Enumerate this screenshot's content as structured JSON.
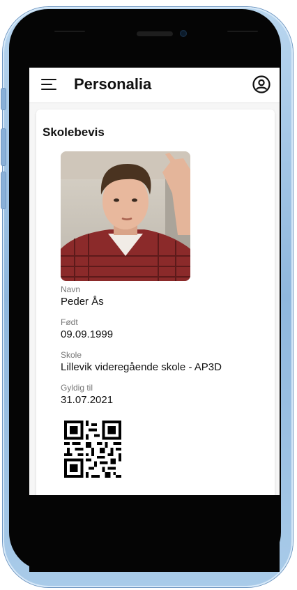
{
  "app_bar": {
    "title": "Personalia",
    "menu_icon": "hamburger-menu-icon",
    "account_icon": "account-circle-icon"
  },
  "card": {
    "title": "Skolebevis",
    "photo_icon": "student-photo",
    "fields": [
      {
        "label": "Navn",
        "value": "Peder Ås"
      },
      {
        "label": "Født",
        "value": "09.09.1999"
      },
      {
        "label": "Skole",
        "value": "Lillevik videregående skole - AP3D"
      },
      {
        "label": "Gyldig til",
        "value": "31.07.2021"
      }
    ],
    "qr_icon": "qr-code"
  },
  "colors": {
    "frame": "#8fb7dd",
    "screen_bg": "#f6f6f6",
    "card_bg": "#ffffff",
    "label": "#777777",
    "text": "#111111"
  }
}
